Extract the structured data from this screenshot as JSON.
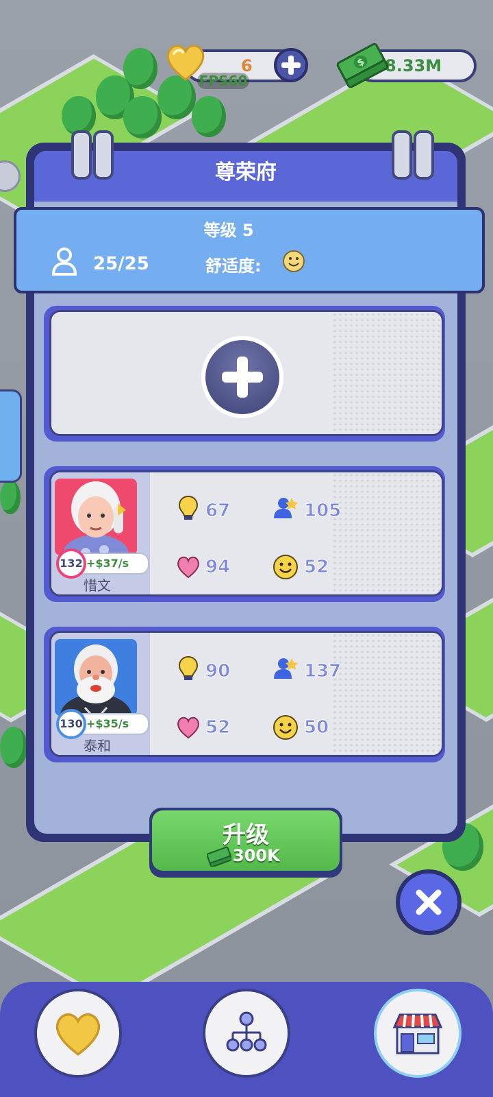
{
  "topbar": {
    "hearts_count": "6",
    "fps_label": "FPS60",
    "money": "8.33M"
  },
  "building": {
    "title": "尊荣府",
    "level_label": "等级 5",
    "occupancy": "25/25",
    "comfort_label": "舒适度:"
  },
  "residents": [
    {
      "name": "惜文",
      "level": "132",
      "income": "+$37/s",
      "stats": {
        "intelligence": "67",
        "social": "105",
        "health": "94",
        "happiness": "52"
      },
      "level_color": "#e8457c"
    },
    {
      "name": "泰和",
      "level": "130",
      "income": "+$35/s",
      "stats": {
        "intelligence": "90",
        "social": "137",
        "health": "52",
        "happiness": "50"
      },
      "level_color": "#4a8fe0"
    }
  ],
  "upgrade": {
    "label": "升级",
    "cost": "300K"
  },
  "colors": {
    "accent": "#5b67d6",
    "panel": "#a3b2d8",
    "green_button": "#5fc355"
  }
}
